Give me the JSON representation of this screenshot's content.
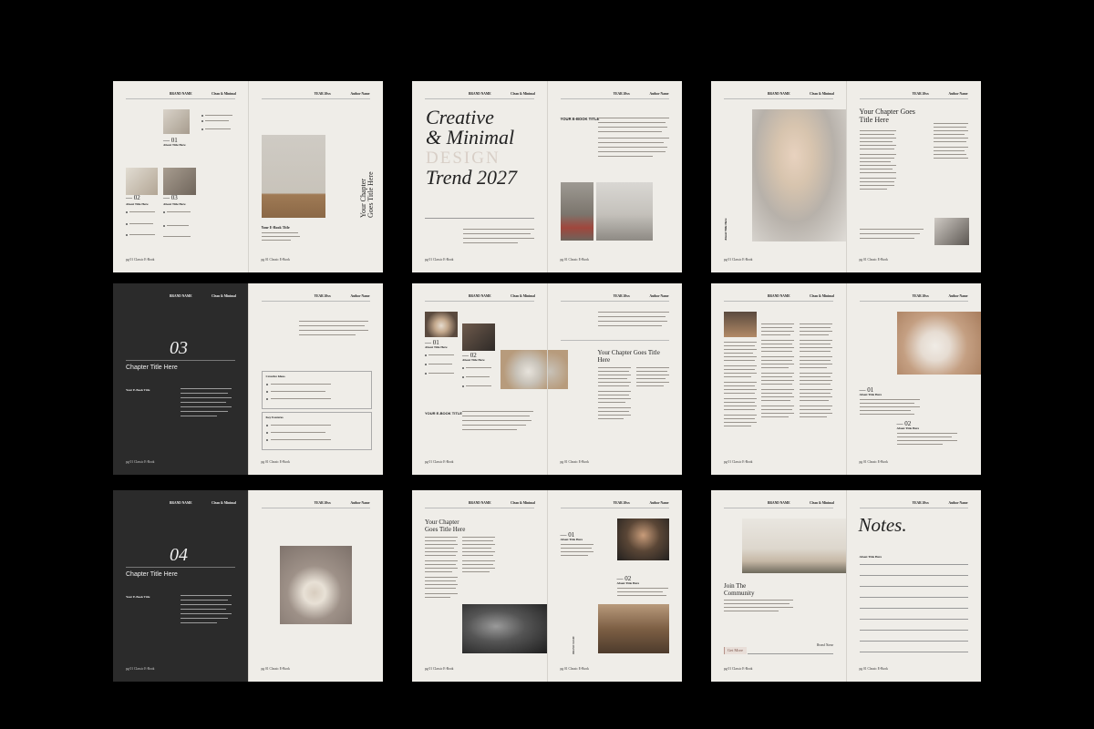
{
  "brand": "BRAND NAME",
  "subtitle": "Clean & Minimal",
  "year": "YEAR 20xx",
  "author": "Author Name",
  "footer": "pg 01 Classic E-Book",
  "about_title": "About Title Here",
  "ebook_title": "YOUR E-BOOK TITLE",
  "your_ebook_title": "Your E-Book Title",
  "chapter_goes": "Your Chapter Goes Title Here",
  "chapter_title": "Chapter Title Here",
  "cover": {
    "line1": "Creative",
    "line2": "& Minimal",
    "line3": "DESIGN",
    "line4": "Trend 2027"
  },
  "nums": {
    "n01": "— 01",
    "n02": "— 02",
    "n03": "— 03"
  },
  "chapter03": "03",
  "chapter04": "04",
  "creative_ideas": "Creative Ideas.",
  "key_features": "Key Features",
  "join": "Join The Community",
  "get_more": "Get More",
  "brand_name_script": "Brand Name",
  "notes": "Notes."
}
